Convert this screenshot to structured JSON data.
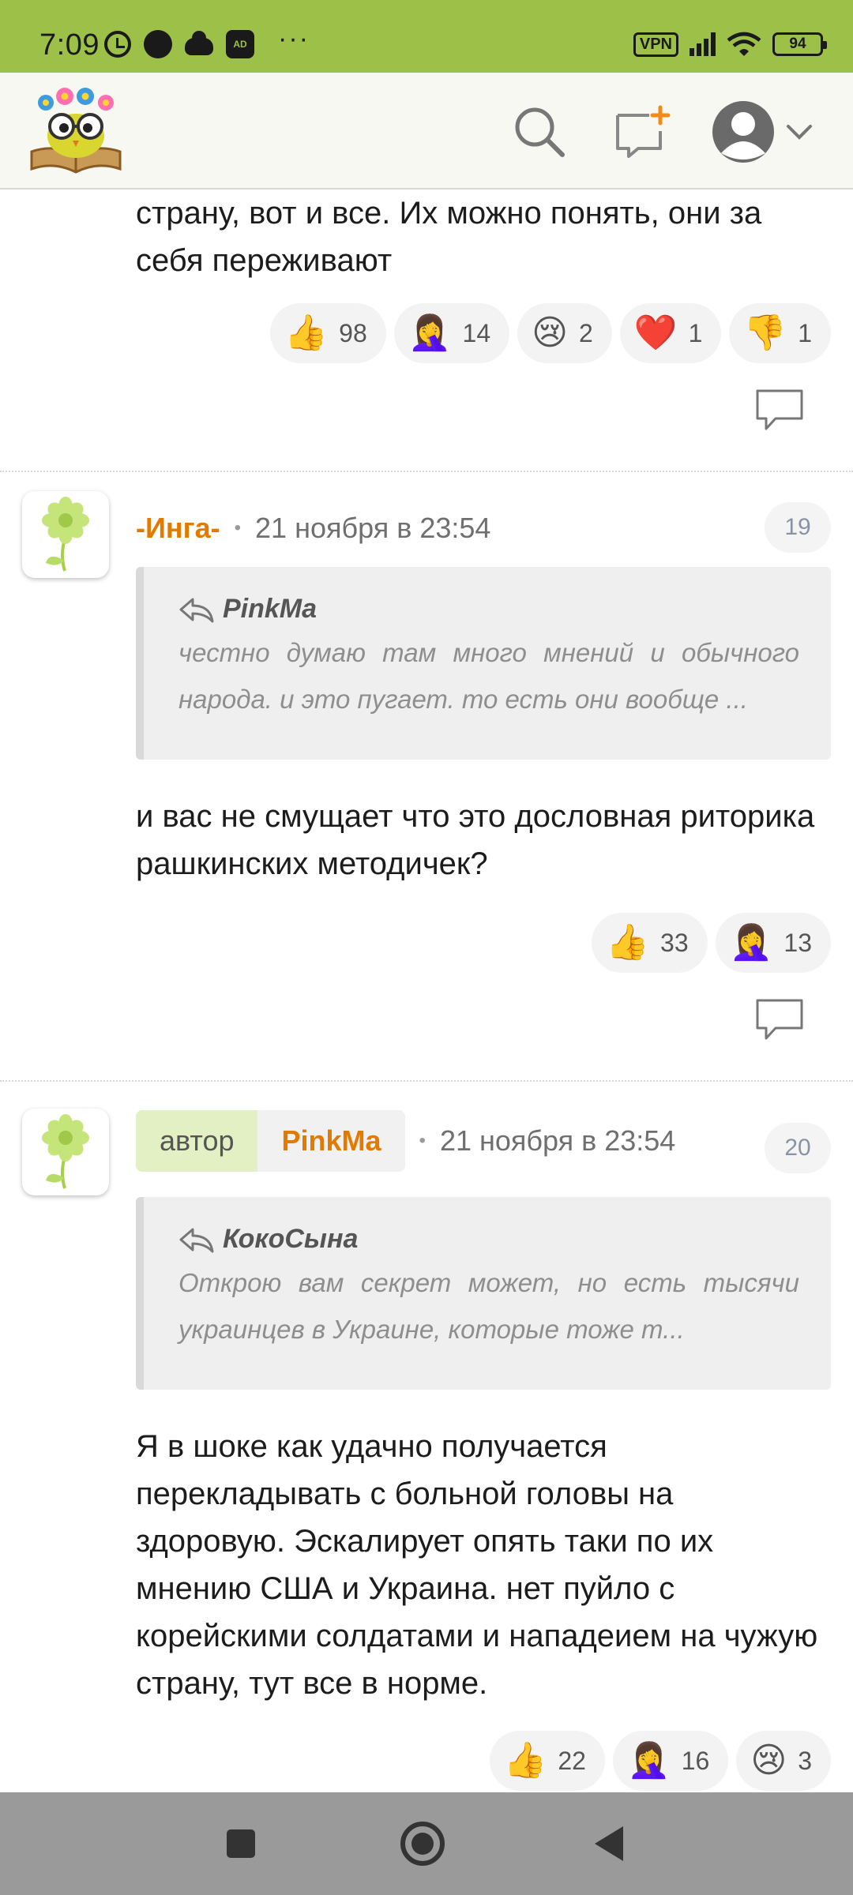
{
  "status_bar": {
    "time": "7:09",
    "ad_icon_text": "AD",
    "more": "···",
    "vpn": "VPN",
    "battery": "94",
    "accent": "#9dc148"
  },
  "header": {
    "logo_icon": "owl-reading-book-logo",
    "search_icon": "search-icon",
    "new_post_icon": "new-message-icon",
    "profile_icon": "user-avatar-icon"
  },
  "comments": [
    {
      "text": "страну, вот и все. Их можно понять, они за себя переживают",
      "reactions": [
        {
          "emoji": "👍",
          "icon": "thumbs-up-icon",
          "count": "98"
        },
        {
          "emoji": "🤦‍♀️",
          "icon": "facepalm-icon",
          "count": "14"
        },
        {
          "emoji": "😢",
          "icon": "crying-face-icon",
          "count": "2"
        },
        {
          "emoji": "❤️",
          "icon": "heart-icon",
          "count": "1"
        },
        {
          "emoji": "👎",
          "icon": "thumbs-down-icon",
          "count": "1"
        }
      ]
    },
    {
      "author": "-Инга-",
      "date": "21 ноября в 23:54",
      "number": "19",
      "quote": {
        "author": "PinkMa",
        "text": "честно думаю там много мнений и обычного народа. и это пугает. то есть они вообще ..."
      },
      "text": "и вас не смущает что это дословная риторика рашкинских методичек?",
      "reactions": [
        {
          "emoji": "👍",
          "icon": "thumbs-up-icon",
          "count": "33"
        },
        {
          "emoji": "🤦‍♀️",
          "icon": "facepalm-icon",
          "count": "13"
        }
      ]
    },
    {
      "badge_role": "автор",
      "author": "PinkMa",
      "date": "21 ноября в 23:54",
      "number": "20",
      "quote": {
        "author": "КокоСына",
        "text": "Открою вам секрет может, но есть тысячи украинцев в Украине, которые тоже т..."
      },
      "text": "Я в шоке как удачно получается перекладывать с больной головы на здоровую. Эскалирует опять таки по их мнению США и Украина. нет пуйло с корейскими солдатами и нападеием на чужую страну, тут все в норме.",
      "reactions": [
        {
          "emoji": "👍",
          "icon": "thumbs-up-icon",
          "count": "22"
        },
        {
          "emoji": "🤦‍♀️",
          "icon": "facepalm-icon",
          "count": "16"
        },
        {
          "emoji": "😢",
          "icon": "crying-face-icon",
          "count": "3"
        }
      ]
    }
  ],
  "nav": {
    "recents_icon": "square-recents-icon",
    "home_icon": "circle-home-icon",
    "back_icon": "triangle-back-icon"
  }
}
